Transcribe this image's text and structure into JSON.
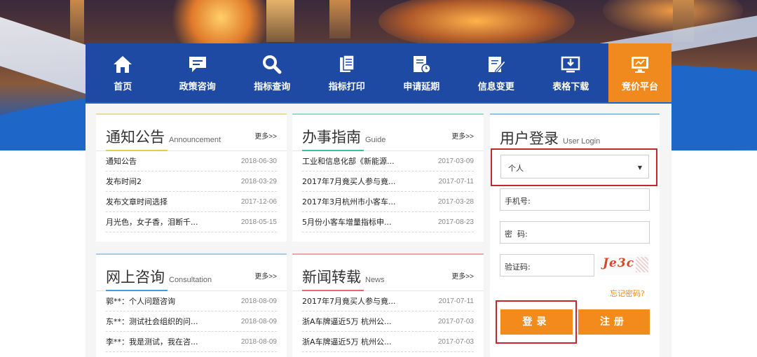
{
  "nav": {
    "items": [
      {
        "label": "首页",
        "icon": "home-icon"
      },
      {
        "label": "政策咨询",
        "icon": "chat-icon"
      },
      {
        "label": "指标查询",
        "icon": "search-icon"
      },
      {
        "label": "指标打印",
        "icon": "document-icon"
      },
      {
        "label": "申请延期",
        "icon": "calendar-clock-icon"
      },
      {
        "label": "信息变更",
        "icon": "edit-icon"
      },
      {
        "label": "表格下载",
        "icon": "download-icon"
      },
      {
        "label": "竞价平台",
        "icon": "monitor-icon"
      }
    ],
    "active_color": "#f08a1e",
    "bar_color": "#1f4aa3"
  },
  "announcements": {
    "title": "通知公告",
    "subtitle": "Announcement",
    "more": "更多>>",
    "rows": [
      {
        "title": "通知公告",
        "date": "2018-06-30"
      },
      {
        "title": "发布时间2",
        "date": "2018-03-29"
      },
      {
        "title": "发布文章时间选择",
        "date": "2017-12-06"
      },
      {
        "title": "月光色，女子香，泪断千...",
        "date": "2018-05-15"
      }
    ]
  },
  "guide": {
    "title": "办事指南",
    "subtitle": "Guide",
    "more": "更多>>",
    "rows": [
      {
        "title": "工业和信息化部《新能源...",
        "date": "2017-03-09"
      },
      {
        "title": "2017年7月竟买人参与竟...",
        "date": "2017-07-11"
      },
      {
        "title": "2017年3月杭州市小客车...",
        "date": "2017-03-28"
      },
      {
        "title": "5月份小客车增量指标申...",
        "date": "2017-08-23"
      }
    ]
  },
  "consultation": {
    "title": "网上咨询",
    "subtitle": "Consultation",
    "more": "更多>>",
    "rows": [
      {
        "title": "郭**：个人问题咨询",
        "date": "2018-08-09"
      },
      {
        "title": "东**：测试社会组织的问...",
        "date": "2018-08-09"
      },
      {
        "title": "李**：我是测试，我在咨...",
        "date": "2018-08-09"
      }
    ]
  },
  "news": {
    "title": "新闻转载",
    "subtitle": "News",
    "more": "更多>>",
    "rows": [
      {
        "title": "2017年7月竟买人参与竟...",
        "date": "2017-07-11"
      },
      {
        "title": "浙A车牌逼近5万 杭州公...",
        "date": "2017-07-03"
      },
      {
        "title": "浙A车牌逼近5万 杭州公...",
        "date": "2017-07-03"
      }
    ]
  },
  "login": {
    "title": "用户登录",
    "subtitle": "User Login",
    "account_type": "个人",
    "phone_label": "手机号:",
    "password_label": "密  码:",
    "code_label": "验证码:",
    "captcha": "Je3c",
    "forgot": "忘记密码?",
    "login_button": "登录",
    "register_button": "注册",
    "button_color": "#f28b1c",
    "highlight_color": "#c8262e"
  }
}
